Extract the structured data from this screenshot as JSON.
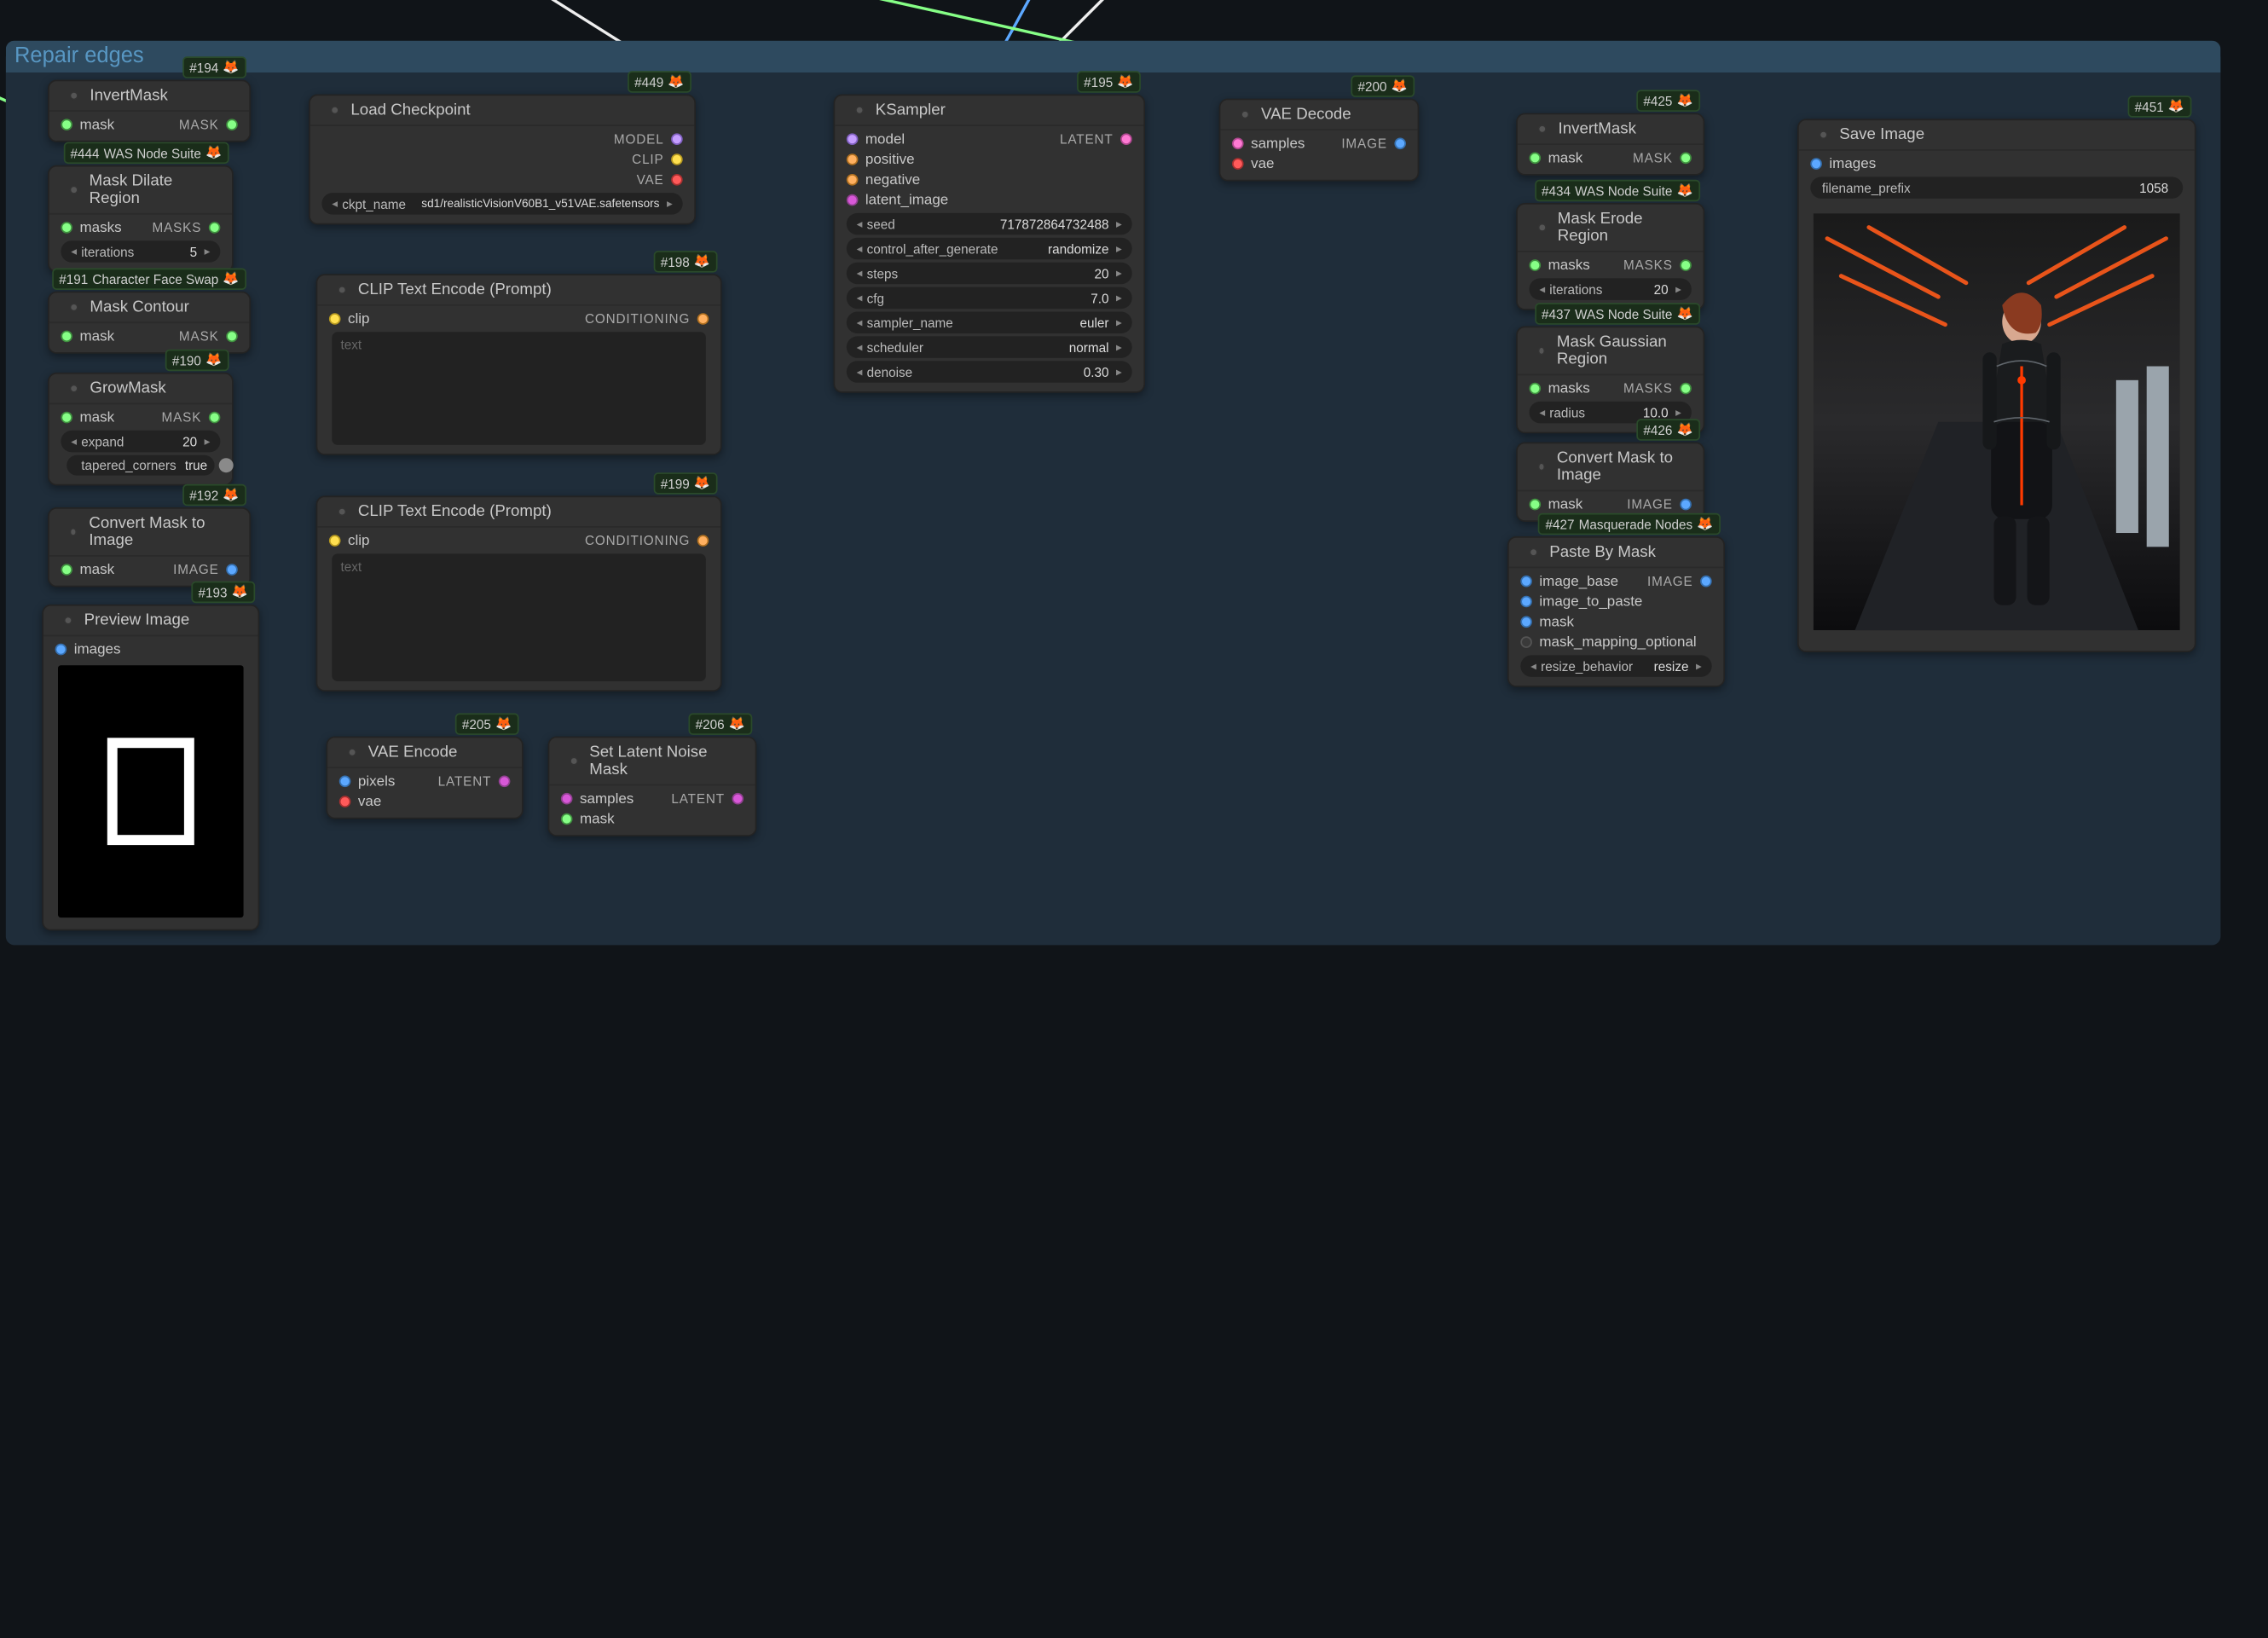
{
  "group": {
    "title": "Repair edges"
  },
  "nodes": {
    "n194": {
      "badge": "#194",
      "title": "InvertMask",
      "in": [
        {
          "label": "mask",
          "color": "green"
        }
      ],
      "out": [
        {
          "label": "MASK",
          "color": "green"
        }
      ]
    },
    "n444": {
      "badge": "#444",
      "badge_suffix": "WAS Node Suite",
      "title": "Mask Dilate Region",
      "in": [
        {
          "label": "masks",
          "color": "green"
        }
      ],
      "out": [
        {
          "label": "MASKS",
          "color": "green"
        }
      ],
      "widgets": [
        {
          "type": "num",
          "label": "iterations",
          "value": "5"
        }
      ]
    },
    "n191": {
      "badge": "#191",
      "badge_suffix": "Character Face Swap",
      "title": "Mask Contour",
      "in": [
        {
          "label": "mask",
          "color": "green"
        }
      ],
      "out": [
        {
          "label": "MASK",
          "color": "green"
        }
      ]
    },
    "n190": {
      "badge": "#190",
      "title": "GrowMask",
      "in": [
        {
          "label": "mask",
          "color": "green"
        }
      ],
      "out": [
        {
          "label": "MASK",
          "color": "green"
        }
      ],
      "widgets": [
        {
          "type": "num",
          "label": "expand",
          "value": "20"
        },
        {
          "type": "bool",
          "label": "tapered_corners",
          "value": "true"
        }
      ]
    },
    "n192": {
      "badge": "#192",
      "title": "Convert Mask to Image",
      "in": [
        {
          "label": "mask",
          "color": "green"
        }
      ],
      "out": [
        {
          "label": "IMAGE",
          "color": "blue"
        }
      ]
    },
    "n193": {
      "badge": "#193",
      "title": "Preview Image",
      "in": [
        {
          "label": "images",
          "color": "blue"
        }
      ]
    },
    "n449": {
      "badge": "#449",
      "title": "Load Checkpoint",
      "out": [
        {
          "label": "MODEL",
          "color": "lav"
        },
        {
          "label": "CLIP",
          "color": "yellow"
        },
        {
          "label": "VAE",
          "color": "red"
        }
      ],
      "widgets": [
        {
          "type": "combo",
          "label": "ckpt_name",
          "value": "sd1/realisticVisionV60B1_v51VAE.safetensors"
        }
      ]
    },
    "n198": {
      "badge": "#198",
      "title": "CLIP Text Encode (Prompt)",
      "in": [
        {
          "label": "clip",
          "color": "yellow"
        }
      ],
      "out": [
        {
          "label": "CONDITIONING",
          "color": "orange"
        }
      ],
      "widgets": [
        {
          "type": "textarea",
          "label": "text",
          "value": "",
          "h": 78
        }
      ]
    },
    "n199": {
      "badge": "#199",
      "title": "CLIP Text Encode (Prompt)",
      "in": [
        {
          "label": "clip",
          "color": "yellow"
        }
      ],
      "out": [
        {
          "label": "CONDITIONING",
          "color": "orange"
        }
      ],
      "widgets": [
        {
          "type": "textarea",
          "label": "text",
          "value": "",
          "h": 88
        }
      ]
    },
    "n205": {
      "badge": "#205",
      "title": "VAE Encode",
      "in": [
        {
          "label": "pixels",
          "color": "blue"
        },
        {
          "label": "vae",
          "color": "red"
        }
      ],
      "out": [
        {
          "label": "LATENT",
          "color": "magenta"
        }
      ]
    },
    "n206": {
      "badge": "#206",
      "title": "Set Latent Noise Mask",
      "in": [
        {
          "label": "samples",
          "color": "magenta"
        },
        {
          "label": "mask",
          "color": "green"
        }
      ],
      "out": [
        {
          "label": "LATENT",
          "color": "magenta"
        }
      ]
    },
    "n195": {
      "badge": "#195",
      "title": "KSampler",
      "in": [
        {
          "label": "model",
          "color": "lav"
        },
        {
          "label": "positive",
          "color": "orange"
        },
        {
          "label": "negative",
          "color": "orange"
        },
        {
          "label": "latent_image",
          "color": "magenta"
        }
      ],
      "out": [
        {
          "label": "LATENT",
          "color": "magenta"
        }
      ],
      "widgets": [
        {
          "type": "num",
          "label": "seed",
          "value": "717872864732488"
        },
        {
          "type": "combo",
          "label": "control_after_generate",
          "value": "randomize"
        },
        {
          "type": "num",
          "label": "steps",
          "value": "20"
        },
        {
          "type": "num",
          "label": "cfg",
          "value": "7.0"
        },
        {
          "type": "combo",
          "label": "sampler_name",
          "value": "euler"
        },
        {
          "type": "combo",
          "label": "scheduler",
          "value": "normal"
        },
        {
          "type": "num",
          "label": "denoise",
          "value": "0.30"
        }
      ]
    },
    "n200": {
      "badge": "#200",
      "title": "VAE Decode",
      "in": [
        {
          "label": "samples",
          "color": "magenta"
        },
        {
          "label": "vae",
          "color": "red"
        }
      ],
      "out": [
        {
          "label": "IMAGE",
          "color": "blue"
        }
      ]
    },
    "n425": {
      "badge": "#425",
      "title": "InvertMask",
      "in": [
        {
          "label": "mask",
          "color": "green"
        }
      ],
      "out": [
        {
          "label": "MASK",
          "color": "green"
        }
      ]
    },
    "n434": {
      "badge": "#434",
      "badge_suffix": "WAS Node Suite",
      "title": "Mask Erode Region",
      "in": [
        {
          "label": "masks",
          "color": "green"
        }
      ],
      "out": [
        {
          "label": "MASKS",
          "color": "green"
        }
      ],
      "widgets": [
        {
          "type": "num",
          "label": "iterations",
          "value": "20"
        }
      ]
    },
    "n437": {
      "badge": "#437",
      "badge_suffix": "WAS Node Suite",
      "title": "Mask Gaussian Region",
      "in": [
        {
          "label": "masks",
          "color": "green"
        }
      ],
      "out": [
        {
          "label": "MASKS",
          "color": "green"
        }
      ],
      "widgets": [
        {
          "type": "num",
          "label": "radius",
          "value": "10.0"
        }
      ]
    },
    "n426": {
      "badge": "#426",
      "title": "Convert Mask to Image",
      "in": [
        {
          "label": "mask",
          "color": "green"
        }
      ],
      "out": [
        {
          "label": "IMAGE",
          "color": "blue"
        }
      ]
    },
    "n427": {
      "badge": "#427",
      "badge_suffix": "Masquerade Nodes",
      "title": "Paste By Mask",
      "in": [
        {
          "label": "image_base",
          "color": "blue"
        },
        {
          "label": "image_to_paste",
          "color": "blue"
        },
        {
          "label": "mask",
          "color": "blue"
        },
        {
          "label": "mask_mapping_optional",
          "color": ""
        }
      ],
      "out": [
        {
          "label": "IMAGE",
          "color": "blue"
        }
      ],
      "widgets": [
        {
          "type": "combo",
          "label": "resize_behavior",
          "value": "resize"
        }
      ]
    },
    "n451": {
      "badge": "#451",
      "title": "Save Image",
      "in": [
        {
          "label": "images",
          "color": "blue"
        }
      ],
      "widgets": [
        {
          "type": "text",
          "label": "filename_prefix",
          "value": "1058"
        }
      ]
    }
  }
}
